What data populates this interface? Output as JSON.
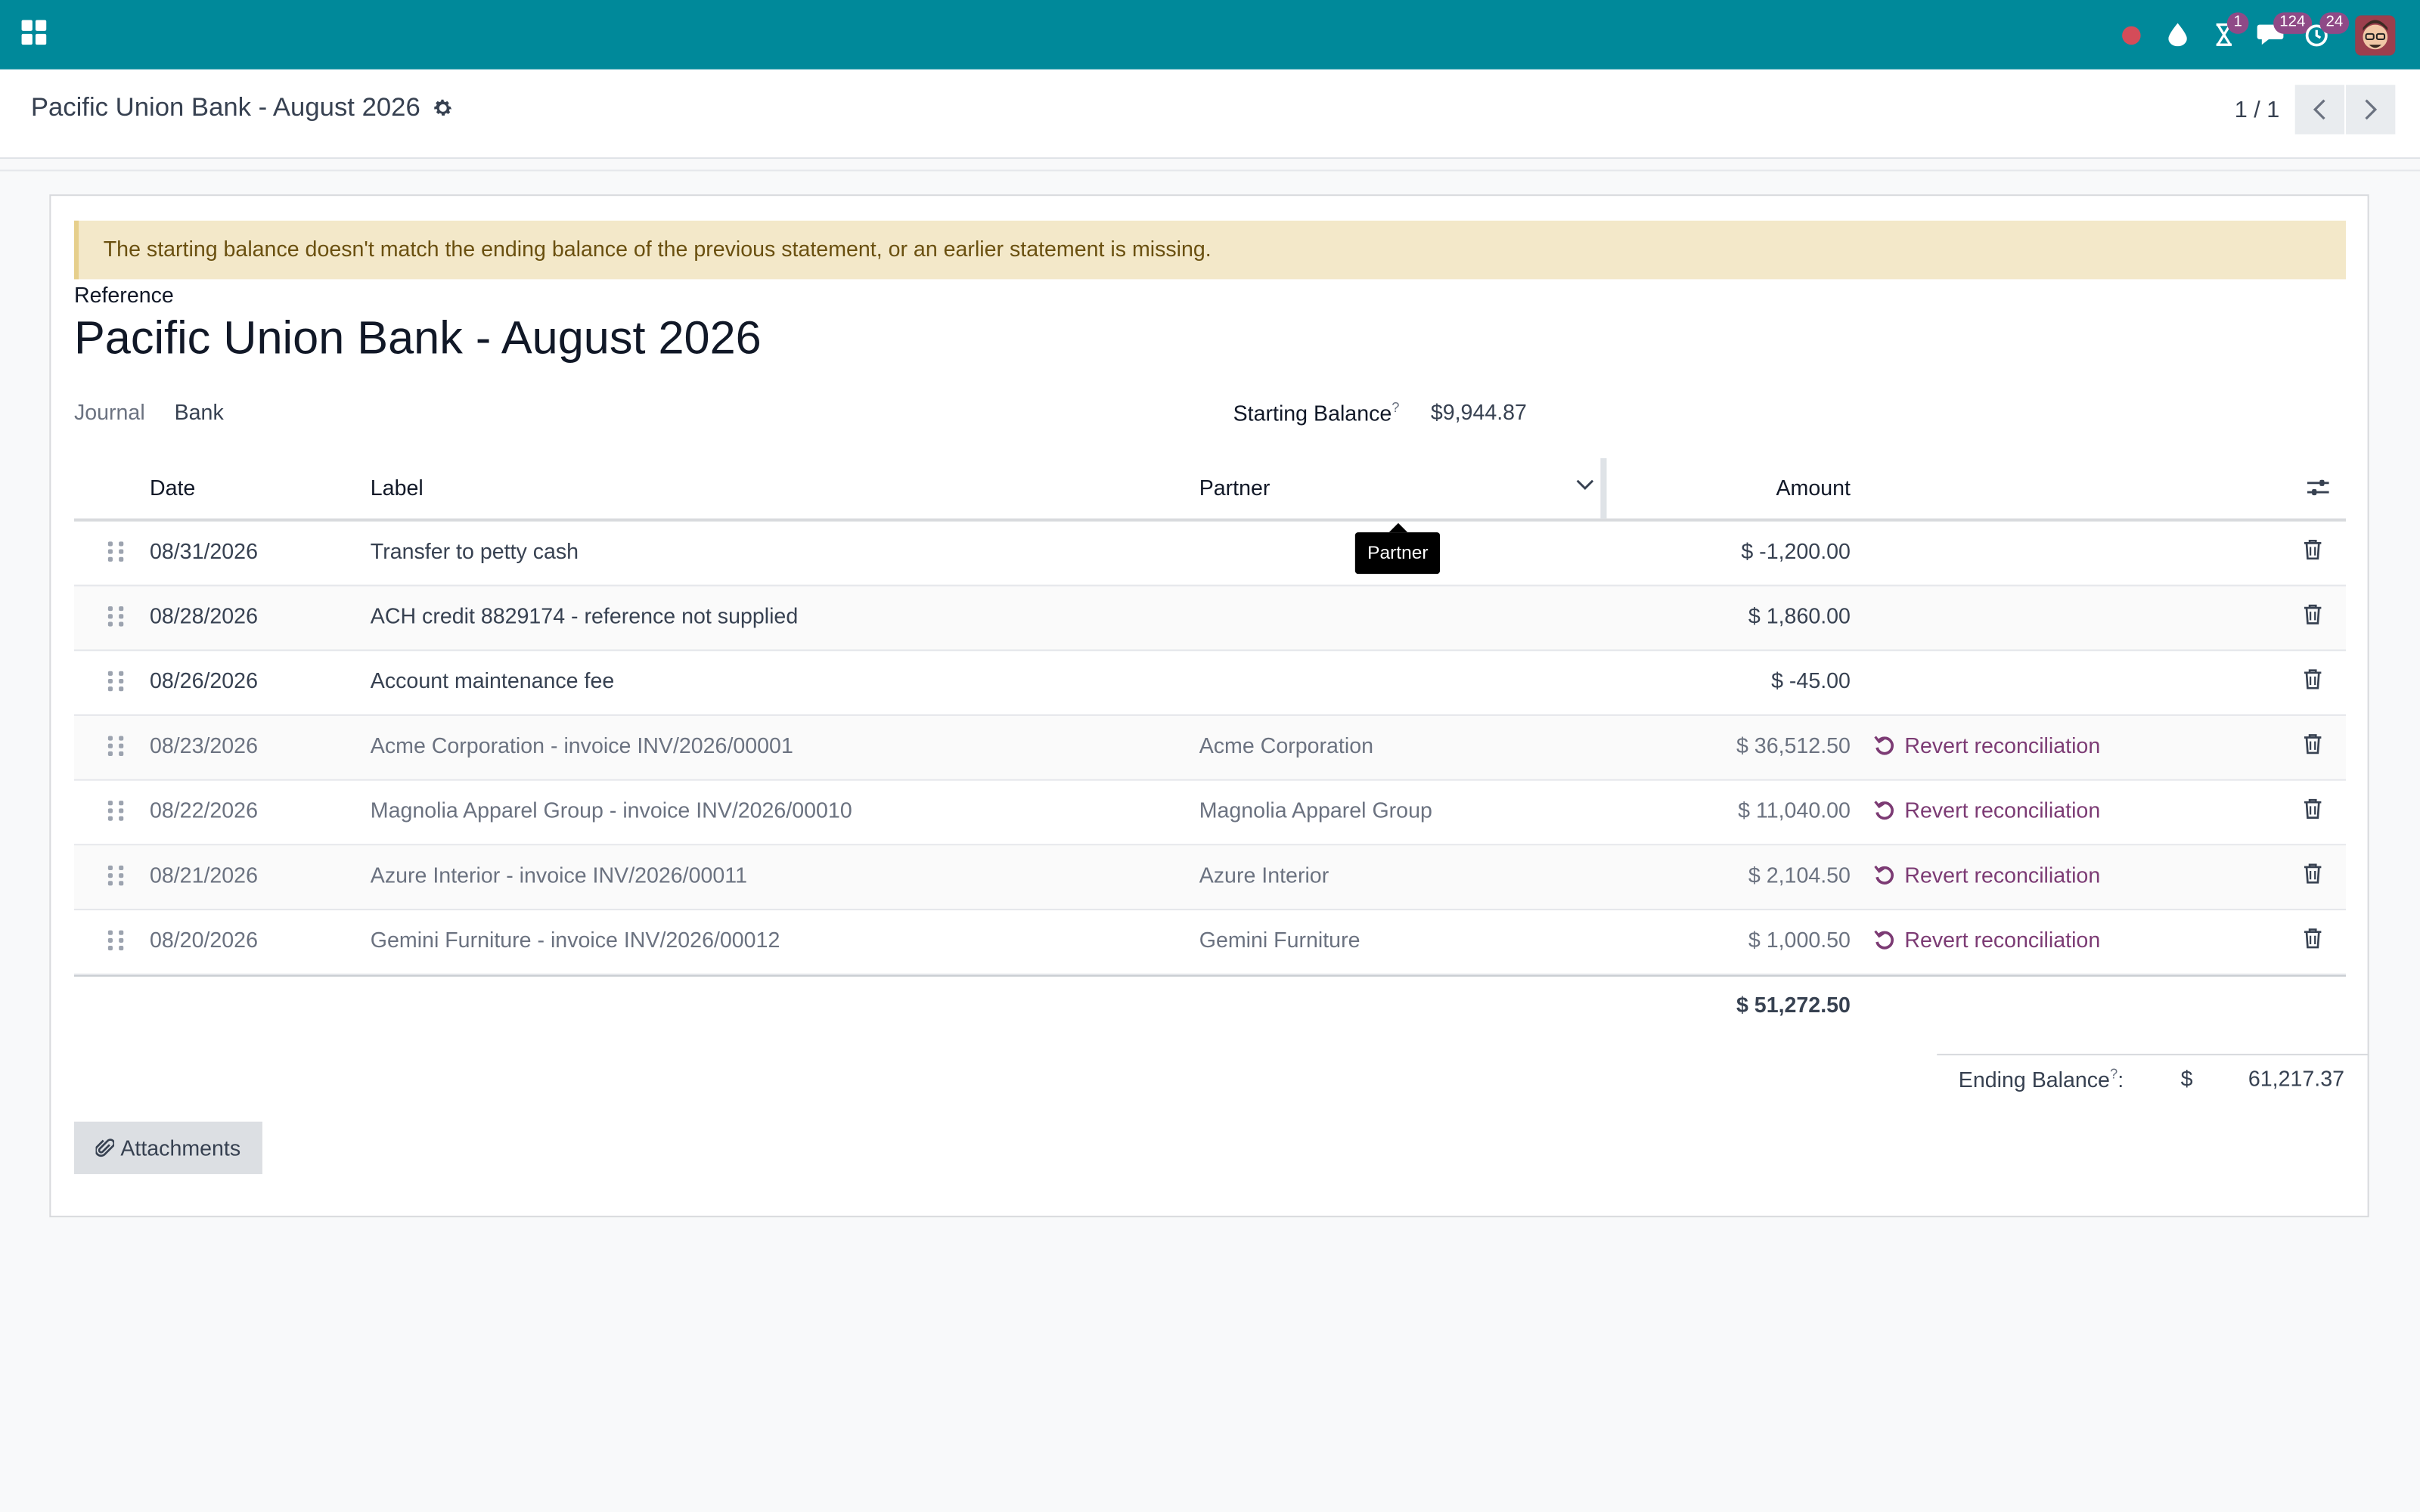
{
  "topbar": {
    "apps_icon": "apps-grid-icon",
    "tray": [
      {
        "icon": "recording-dot-icon",
        "badge": null
      },
      {
        "icon": "droplet-icon",
        "badge": null
      },
      {
        "icon": "hourglass-icon",
        "badge": "1"
      },
      {
        "icon": "chat-icon",
        "badge": "124"
      },
      {
        "icon": "clock-activity-icon",
        "badge": "24"
      }
    ],
    "accent_color": "#00899a",
    "badge_color": "#8f4a87"
  },
  "control_panel": {
    "breadcrumb": "Pacific Union Bank - August 2026",
    "pager_value": "1 / 1"
  },
  "alert": {
    "text": "The starting balance doesn't match the ending balance of the previous statement, or an earlier statement is missing."
  },
  "form": {
    "reference_label": "Reference",
    "title": "Pacific Union Bank - August 2026",
    "journal_label": "Journal",
    "journal_value": "Bank",
    "starting_balance_label": "Starting Balance",
    "help_mark": "?",
    "starting_balance_value": "$9,944.87"
  },
  "table": {
    "headers": {
      "date": "Date",
      "label": "Label",
      "partner": "Partner",
      "amount": "Amount"
    },
    "rows": [
      {
        "date": "08/31/2026",
        "label": "Transfer to petty cash",
        "partner": "",
        "amount": "$ -1,200.00",
        "action": ""
      },
      {
        "date": "08/28/2026",
        "label": "ACH credit 8829174 - reference not supplied",
        "partner": "",
        "amount": "$ 1,860.00",
        "action": ""
      },
      {
        "date": "08/26/2026",
        "label": "Account maintenance fee",
        "partner": "",
        "amount": "$ -45.00",
        "action": ""
      },
      {
        "date": "08/23/2026",
        "label": "Acme Corporation - invoice INV/2026/00001",
        "partner": "Acme Corporation",
        "amount": "$ 36,512.50",
        "action": "Revert reconciliation"
      },
      {
        "date": "08/22/2026",
        "label": "Magnolia Apparel Group - invoice INV/2026/00010",
        "partner": "Magnolia Apparel Group",
        "amount": "$ 11,040.00",
        "action": "Revert reconciliation"
      },
      {
        "date": "08/21/2026",
        "label": "Azure Interior - invoice INV/2026/00011",
        "partner": "Azure Interior",
        "amount": "$ 2,104.50",
        "action": "Revert reconciliation"
      },
      {
        "date": "08/20/2026",
        "label": "Gemini Furniture - invoice INV/2026/00012",
        "partner": "Gemini Furniture",
        "amount": "$ 1,000.50",
        "action": "Revert reconciliation"
      }
    ],
    "total": "$ 51,272.50"
  },
  "ending_balance": {
    "label": "Ending Balance",
    "help_mark": "?",
    "colon": ":",
    "currency": "$",
    "value": "61,217.37"
  },
  "attachments_label": "Attachments",
  "tooltip_text": "Partner",
  "link_color": "#7c3b74"
}
